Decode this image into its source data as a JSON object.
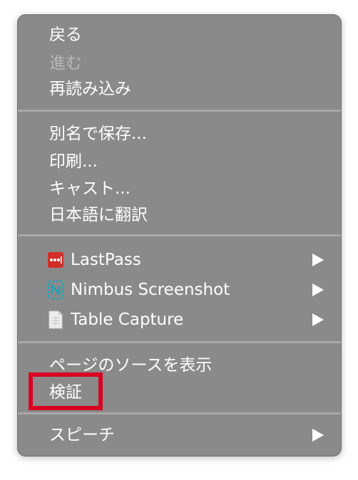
{
  "menu": {
    "group1": [
      {
        "label": "戻る",
        "enabled": true
      },
      {
        "label": "進む",
        "enabled": false
      },
      {
        "label": "再読み込み",
        "enabled": true
      }
    ],
    "group2": [
      {
        "label": "別名で保存..."
      },
      {
        "label": "印刷..."
      },
      {
        "label": "キャスト..."
      },
      {
        "label": "日本語に翻訳"
      }
    ],
    "group3": [
      {
        "label": "LastPass",
        "icon": "lastpass-icon",
        "has_submenu": true
      },
      {
        "label": "Nimbus Screenshot",
        "icon": "nimbus-screenshot-icon",
        "has_submenu": true
      },
      {
        "label": "Table Capture",
        "icon": "table-capture-icon",
        "has_submenu": true
      }
    ],
    "group4": [
      {
        "label": "ページのソースを表示"
      },
      {
        "label": "検証",
        "highlighted": true
      }
    ],
    "group5": [
      {
        "label": "スピーチ",
        "has_submenu": true
      }
    ]
  },
  "colors": {
    "menu_background": "#8a8a8a",
    "text": "#ffffff",
    "disabled_text": "#b8b8b8",
    "separator": "#a9a9a9",
    "highlight_border": "#d80022",
    "lastpass_red": "#d32d27",
    "nimbus_teal": "#1aa3b8"
  }
}
